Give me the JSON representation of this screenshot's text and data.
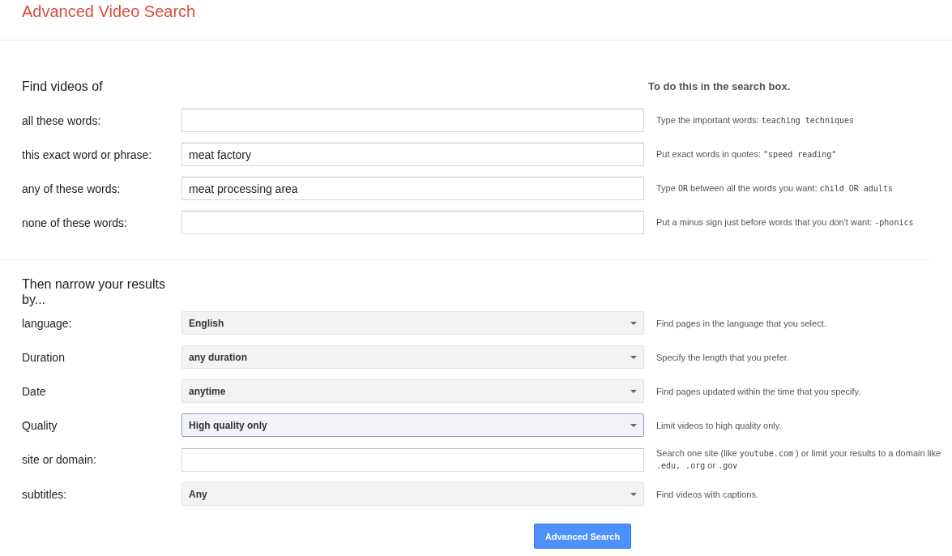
{
  "title": "Advanced Video Search",
  "find_section": {
    "heading": "Find videos of",
    "help_heading": "To do this in the search box.",
    "rows": [
      {
        "kind": "text",
        "label": "all these words:",
        "hint": [
          {
            "text": "Type the important words: ",
            "code": false
          },
          {
            "text": "teaching techniques",
            "code": true
          }
        ]
      },
      {
        "kind": "text",
        "label": "this exact word or phrase:",
        "value": "meat factory",
        "hint": [
          {
            "text": "Put exact words in quotes: ",
            "code": false
          },
          {
            "text": "\"speed reading\"",
            "code": true
          }
        ]
      },
      {
        "kind": "text",
        "label": "any of these words:",
        "value": "meat processing area",
        "hint": [
          {
            "text": "Type ",
            "code": false
          },
          {
            "text": "OR",
            "code": true
          },
          {
            "text": " between all the words you want: ",
            "code": false
          },
          {
            "text": "child OR adults",
            "code": true
          }
        ]
      },
      {
        "kind": "text",
        "label": "none of these words:",
        "hint": [
          {
            "text": "Put a minus sign just before words that you don't want: ",
            "code": false
          },
          {
            "text": "-phonics",
            "code": true
          }
        ]
      }
    ]
  },
  "narrow_section": {
    "heading": "Then narrow your results by...",
    "rows": [
      {
        "kind": "select",
        "label": "language:",
        "value": "English",
        "focused": false,
        "hint": [
          {
            "text": "Find pages in the language that you select.",
            "code": false
          }
        ]
      },
      {
        "kind": "select",
        "label": "Duration",
        "value": "any duration",
        "focused": false,
        "hint": [
          {
            "text": "Specify the length that you prefer.",
            "code": false
          }
        ]
      },
      {
        "kind": "select",
        "label": "Date",
        "value": "anytime",
        "focused": false,
        "hint": [
          {
            "text": "Find pages updated within the time that you specify.",
            "code": false
          }
        ]
      },
      {
        "kind": "select",
        "label": "Quality",
        "value": "High quality only",
        "focused": true,
        "hint": [
          {
            "text": "Limit videos to high quality only.",
            "code": false
          }
        ]
      },
      {
        "kind": "text",
        "label": "site or domain:",
        "hint": [
          {
            "text": "Search one site (like ",
            "code": false
          },
          {
            "text": "youtube.com",
            "code": true
          },
          {
            "text": " ) or limit your results to a domain like ",
            "code": false
          },
          {
            "text": ".edu, .org",
            "code": true
          },
          {
            "text": " or ",
            "code": false
          },
          {
            "text": ".gov",
            "code": true
          }
        ]
      },
      {
        "kind": "select",
        "label": "subtitles:",
        "value": "Any",
        "focused": false,
        "hint": [
          {
            "text": "Find videos with captions.",
            "code": false
          }
        ]
      }
    ]
  },
  "submit_button": "Advanced Search"
}
